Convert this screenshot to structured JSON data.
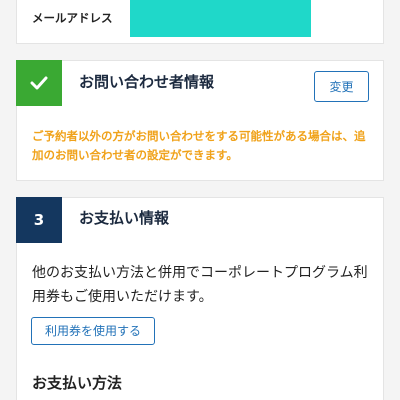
{
  "email_card": {
    "label": "メールアドレス"
  },
  "contact_section": {
    "status_icon": "check-icon",
    "title": "お問い合わせ者情報",
    "change_button_label": "変更",
    "notice": "ご予約者以外の方がお問い合わせをする可能性がある場合は、追加のお問い合わせ者の設定ができます。"
  },
  "payment_section": {
    "step_number": "3",
    "title": "お支払い情報",
    "description": "他のお支払い方法と併用でコーポレートプログラム利用券もご使用いただけます。",
    "voucher_button_label": "利用券を使用する",
    "method_heading": "お支払い方法"
  },
  "colors": {
    "page_bg": "#f4f4f4",
    "card_bg": "#ffffff",
    "card_border": "#e4e4e4",
    "redaction": "#1fd8c9",
    "success_green": "#3aa933",
    "step_navy": "#14375f",
    "title_navy": "#1c2a3f",
    "accent_blue": "#2272b8",
    "notice_orange": "#f0a21a",
    "text_dark": "#222222"
  }
}
